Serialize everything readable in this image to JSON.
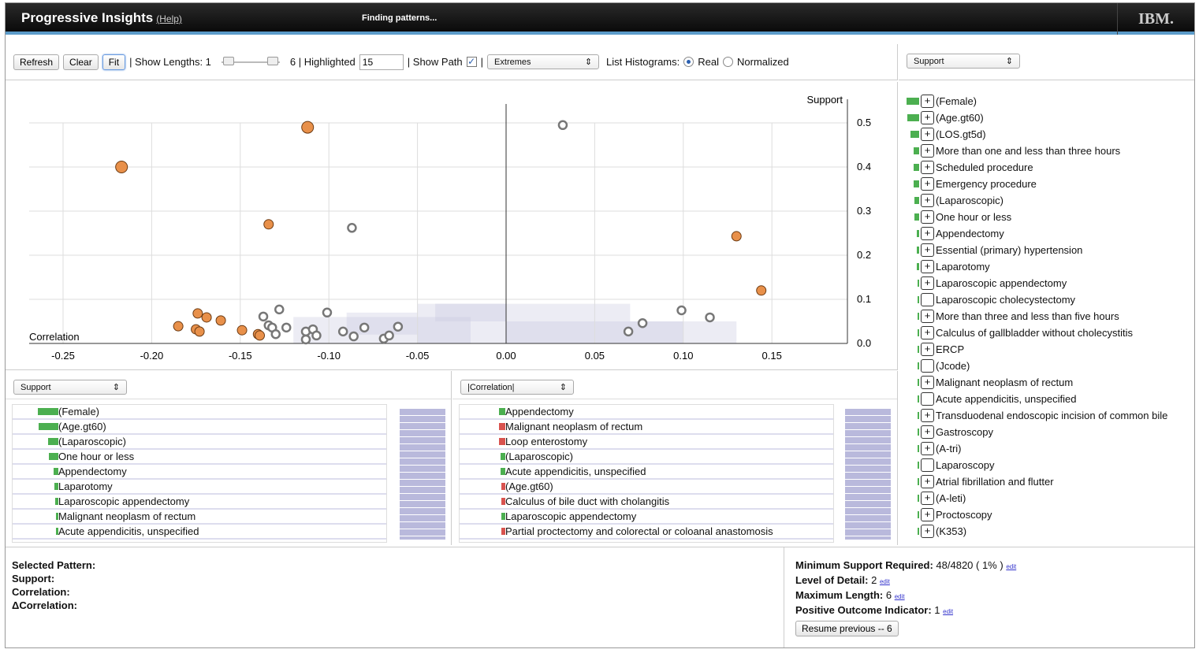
{
  "header": {
    "title": "Progressive Insights",
    "help": "(Help)",
    "status": "Finding patterns...",
    "logo": "IBM."
  },
  "toolbar": {
    "refresh": "Refresh",
    "clear": "Clear",
    "fit": "Fit",
    "show_lengths": "| Show Lengths: 1",
    "lengths_max": "6 | Highlighted",
    "highlighted": "15",
    "show_path": "| Show Path",
    "sep": "|",
    "mode": "Extremes",
    "list_histograms": "List Histograms:",
    "real": "Real",
    "normalized": "Normalized",
    "right_select": "Support"
  },
  "chart_data": {
    "type": "scatter",
    "xlabel": "Correlation",
    "ylabel": "Support",
    "xlim": [
      -0.265,
      0.195
    ],
    "ylim": [
      0,
      0.55
    ],
    "xticks": [
      "-0.25",
      "-0.20",
      "-0.15",
      "-0.10",
      "-0.05",
      "0.00",
      "0.05",
      "0.10",
      "0.15"
    ],
    "xtick_vals": [
      -0.25,
      -0.2,
      -0.15,
      -0.1,
      -0.05,
      0,
      0.05,
      0.1,
      0.15
    ],
    "yticks": [
      "0.0",
      "0.1",
      "0.2",
      "0.3",
      "0.4",
      "0.5"
    ],
    "ytick_vals": [
      0,
      0.1,
      0.2,
      0.3,
      0.4,
      0.5
    ],
    "series": [
      {
        "name": "highlighted",
        "color": "#e8904a",
        "points": [
          [
            -0.112,
            0.49
          ],
          [
            -0.217,
            0.4
          ],
          [
            -0.134,
            0.27
          ],
          [
            0.13,
            0.243
          ],
          [
            0.144,
            0.12
          ],
          [
            -0.174,
            0.068
          ],
          [
            -0.169,
            0.059
          ],
          [
            -0.161,
            0.052
          ],
          [
            -0.185,
            0.039
          ],
          [
            -0.175,
            0.032
          ],
          [
            -0.173,
            0.027
          ],
          [
            -0.149,
            0.03
          ],
          [
            -0.14,
            0.021
          ],
          [
            -0.139,
            0.018
          ]
        ]
      },
      {
        "name": "other",
        "color": "#777777",
        "points": [
          [
            0.032,
            0.495
          ],
          [
            -0.087,
            0.262
          ],
          [
            -0.128,
            0.077
          ],
          [
            -0.101,
            0.07
          ],
          [
            -0.137,
            0.061
          ],
          [
            0.099,
            0.075
          ],
          [
            0.115,
            0.059
          ],
          [
            0.077,
            0.046
          ],
          [
            0.069,
            0.027
          ],
          [
            -0.061,
            0.038
          ],
          [
            -0.08,
            0.036
          ],
          [
            -0.092,
            0.027
          ],
          [
            -0.124,
            0.036
          ],
          [
            -0.134,
            0.041
          ],
          [
            -0.132,
            0.036
          ],
          [
            -0.113,
            0.027
          ],
          [
            -0.109,
            0.032
          ],
          [
            -0.107,
            0.018
          ],
          [
            -0.113,
            0.009
          ],
          [
            -0.13,
            0.021
          ],
          [
            -0.086,
            0.016
          ],
          [
            -0.069,
            0.011
          ],
          [
            -0.066,
            0.018
          ]
        ]
      }
    ]
  },
  "right_list": [
    {
      "label": "(Female)",
      "bar": 1
    },
    {
      "label": "(Age.gt60)",
      "bar": 0.95
    },
    {
      "label": "(LOS.gt5d)",
      "bar": 0.7
    },
    {
      "label": "More than one and less than three hours",
      "bar": 0.45
    },
    {
      "label": "Scheduled procedure",
      "bar": 0.45
    },
    {
      "label": "Emergency procedure",
      "bar": 0.45
    },
    {
      "label": "(Laparoscopic)",
      "bar": 0.4
    },
    {
      "label": "One hour or less",
      "bar": 0.4
    },
    {
      "label": "Appendectomy",
      "bar": 0.2
    },
    {
      "label": "Essential (primary) hypertension",
      "bar": 0.2
    },
    {
      "label": "Laparotomy",
      "bar": 0.2
    },
    {
      "label": "Laparoscopic appendectomy",
      "bar": 0.15
    },
    {
      "label": "Laparoscopic cholecystectomy",
      "bar": 0.15,
      "noplus": true
    },
    {
      "label": "More than three and less than five hours",
      "bar": 0.15
    },
    {
      "label": "Calculus of gallbladder without cholecystitis",
      "bar": 0.15
    },
    {
      "label": "ERCP",
      "bar": 0.1
    },
    {
      "label": "(Jcode)",
      "bar": 0.1,
      "noplus": true
    },
    {
      "label": "Malignant neoplasm of rectum",
      "bar": 0.1
    },
    {
      "label": "Acute appendicitis, unspecified",
      "bar": 0.1,
      "noplus": true
    },
    {
      "label": "Transduodenal endoscopic incision of common bile",
      "bar": 0.1
    },
    {
      "label": "Gastroscopy",
      "bar": 0.1
    },
    {
      "label": "(A-tri)",
      "bar": 0.1
    },
    {
      "label": "Laparoscopy",
      "bar": 0.1,
      "noplus": true
    },
    {
      "label": "Atrial fibrillation and flutter",
      "bar": 0.1
    },
    {
      "label": "(A-leti)",
      "bar": 0.1
    },
    {
      "label": "Proctoscopy",
      "bar": 0.1
    },
    {
      "label": "(K353)",
      "bar": 0.1
    }
  ],
  "bottom_left": {
    "select": "Support",
    "items": [
      {
        "label": "(Female)",
        "bar": 1,
        "color": "#4caf50"
      },
      {
        "label": "(Age.gt60)",
        "bar": 0.95,
        "color": "#4caf50"
      },
      {
        "label": "(Laparoscopic)",
        "bar": 0.5,
        "color": "#4caf50"
      },
      {
        "label": "One hour or less",
        "bar": 0.45,
        "color": "#4caf50"
      },
      {
        "label": "Appendectomy",
        "bar": 0.25,
        "color": "#4caf50"
      },
      {
        "label": "Laparotomy",
        "bar": 0.2,
        "color": "#4caf50"
      },
      {
        "label": "Laparoscopic appendectomy",
        "bar": 0.15,
        "color": "#4caf50"
      },
      {
        "label": "Malignant neoplasm of rectum",
        "bar": 0.1,
        "color": "#4caf50"
      },
      {
        "label": "Acute appendicitis, unspecified",
        "bar": 0.1,
        "color": "#4caf50"
      }
    ]
  },
  "bottom_mid": {
    "select": "|Correlation|",
    "items": [
      {
        "label": "Appendectomy",
        "bar": 0.3,
        "color": "#4caf50"
      },
      {
        "label": "Malignant neoplasm of rectum",
        "bar": 0.3,
        "color": "#d9534f"
      },
      {
        "label": "Loop enterostomy",
        "bar": 0.3,
        "color": "#d9534f"
      },
      {
        "label": "(Laparoscopic)",
        "bar": 0.25,
        "color": "#4caf50"
      },
      {
        "label": "Acute appendicitis, unspecified",
        "bar": 0.25,
        "color": "#4caf50"
      },
      {
        "label": "(Age.gt60)",
        "bar": 0.2,
        "color": "#d9534f"
      },
      {
        "label": "Calculus of bile duct with cholangitis",
        "bar": 0.2,
        "color": "#d9534f"
      },
      {
        "label": "Laparoscopic appendectomy",
        "bar": 0.2,
        "color": "#4caf50"
      },
      {
        "label": "Partial proctectomy and colorectal or coloanal anastomosis",
        "bar": 0.2,
        "color": "#d9534f"
      }
    ]
  },
  "selected": {
    "pattern": "Selected Pattern:",
    "support": "Support:",
    "correlation": "Correlation:",
    "dcorrelation": "ΔCorrelation:"
  },
  "params": {
    "min_support_label": "Minimum Support Required:",
    "min_support": "48/4820 ( 1% )",
    "lod_label": "Level of Detail:",
    "lod": "2",
    "maxlen_label": "Maximum Length:",
    "maxlen": "6",
    "poi_label": "Positive Outcome Indicator:",
    "poi": "1",
    "edit": "edit",
    "resume": "Resume previous -- 6"
  }
}
